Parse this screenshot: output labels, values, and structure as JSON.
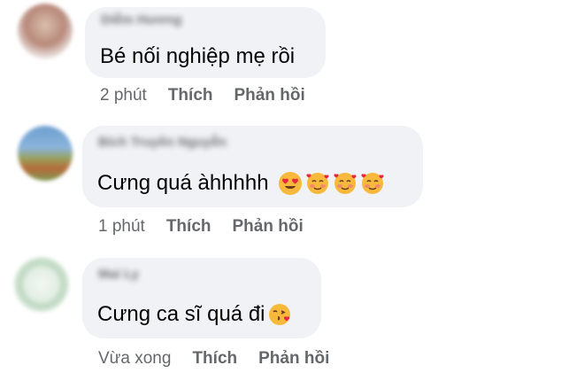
{
  "comments": [
    {
      "author": "Diễm Hương",
      "text": "Bé nối nghiệp mẹ rồi",
      "emojis": [],
      "time": "2 phút",
      "like_label": "Thích",
      "reply_label": "Phản hồi"
    },
    {
      "author": "Bích Truyền Nguyễn",
      "text": "Cưng quá àhhhhh",
      "emojis": [
        "heart-eyes-icon",
        "smiling-face-with-hearts-icon",
        "smiling-face-with-hearts-icon",
        "smiling-face-with-hearts-icon"
      ],
      "time": "1 phút",
      "like_label": "Thích",
      "reply_label": "Phản hồi"
    },
    {
      "author": "Mai Ly",
      "text": "Cưng ca sĩ quá đi",
      "emojis": [
        "kissing-heart-icon"
      ],
      "time": "Vừa xong",
      "like_label": "Thích",
      "reply_label": "Phản hồi"
    }
  ]
}
